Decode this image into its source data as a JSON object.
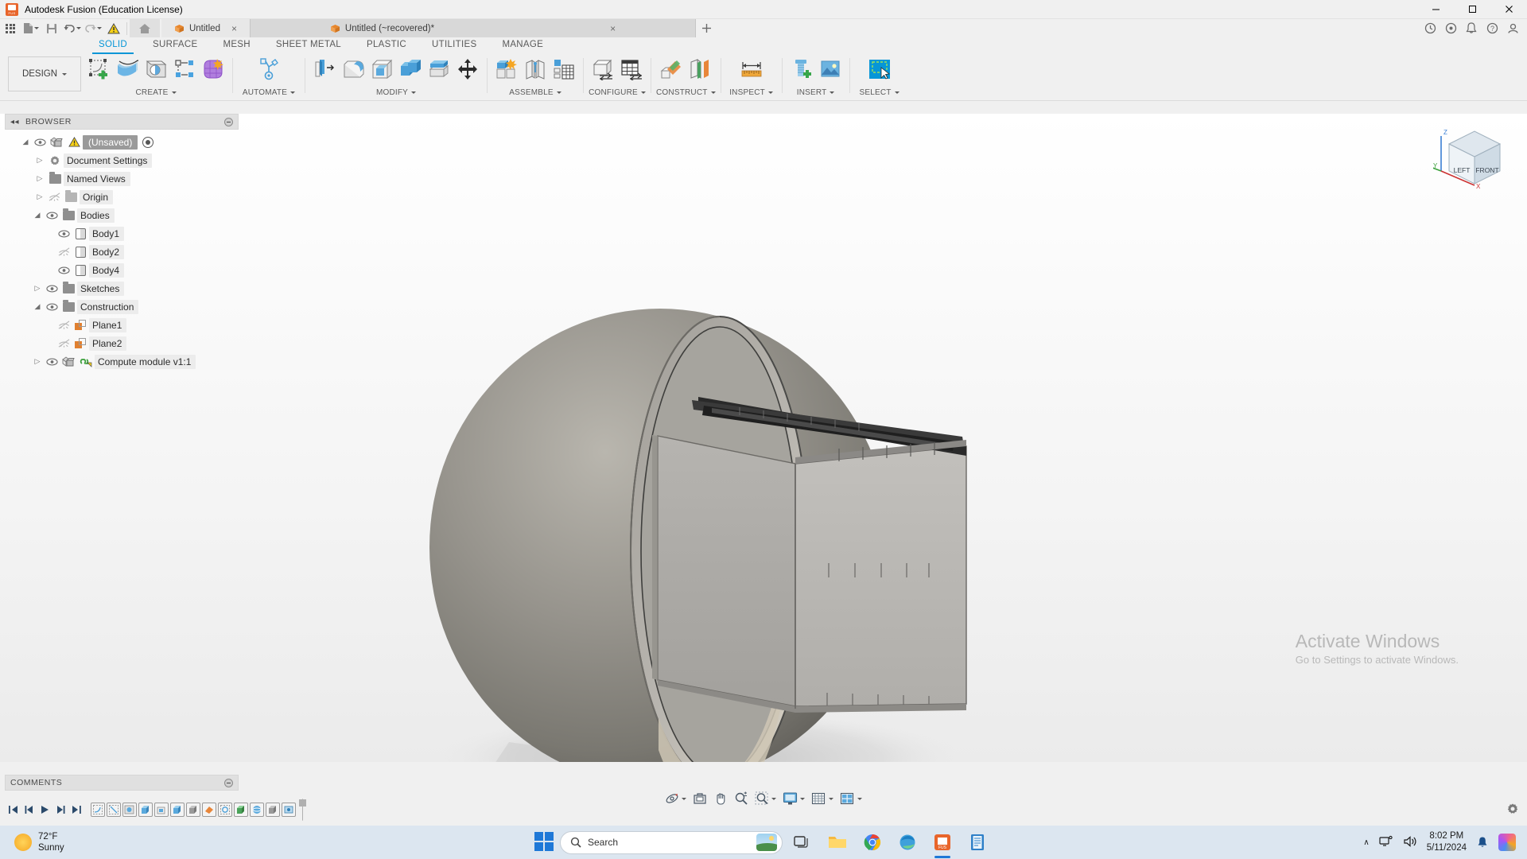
{
  "titlebar": {
    "title": "Autodesk Fusion (Education License)",
    "app_icon": "fusion-logo-icon",
    "minimize": "minimize-icon",
    "maximize": "maximize-icon",
    "close": "close-icon"
  },
  "quick_access": {
    "items": [
      {
        "name": "app-grid-icon",
        "label": ""
      },
      {
        "name": "new-document-icon",
        "label": ""
      },
      {
        "name": "save-icon",
        "label": ""
      },
      {
        "name": "undo-icon",
        "label": ""
      },
      {
        "name": "redo-icon",
        "label": ""
      },
      {
        "name": "warning-icon",
        "label": ""
      }
    ],
    "home_label": "home-icon",
    "tabs": [
      {
        "label": "Untitled",
        "active": true,
        "close": "×"
      },
      {
        "label": "Untitled (~recovered)*",
        "active": false,
        "close": "×"
      }
    ],
    "right_icons": [
      "add-tab-icon",
      "job-status-icon",
      "extensions-icon",
      "notifications-icon",
      "help-icon",
      "account-icon"
    ]
  },
  "ribbon": {
    "tabs": [
      {
        "label": "SOLID",
        "active": true
      },
      {
        "label": "SURFACE",
        "active": false
      },
      {
        "label": "MESH",
        "active": false
      },
      {
        "label": "SHEET METAL",
        "active": false
      },
      {
        "label": "PLASTIC",
        "active": false
      },
      {
        "label": "UTILITIES",
        "active": false
      },
      {
        "label": "MANAGE",
        "active": false
      }
    ],
    "workspace_selector": {
      "label": "DESIGN",
      "caret": "▾"
    },
    "panels": [
      {
        "label": "CREATE",
        "commands": [
          {
            "name": "create-sketch-icon"
          },
          {
            "name": "loft-icon"
          },
          {
            "name": "revolve-icon"
          },
          {
            "name": "pattern-icon"
          },
          {
            "name": "form-icon"
          }
        ]
      },
      {
        "label": "AUTOMATE",
        "commands": [
          {
            "name": "automated-modeling-icon"
          }
        ]
      },
      {
        "label": "MODIFY",
        "commands": [
          {
            "name": "press-pull-icon"
          },
          {
            "name": "fillet-icon"
          },
          {
            "name": "shell-icon"
          },
          {
            "name": "combine-icon"
          },
          {
            "name": "split-face-icon"
          },
          {
            "name": "move-copy-icon"
          }
        ]
      },
      {
        "label": "ASSEMBLE",
        "commands": [
          {
            "name": "new-component-icon"
          },
          {
            "name": "joint-icon"
          },
          {
            "name": "bill-of-materials-icon"
          }
        ]
      },
      {
        "label": "CONFIGURE",
        "commands": [
          {
            "name": "configured-feature-icon"
          },
          {
            "name": "configuration-table-icon"
          }
        ]
      },
      {
        "label": "CONSTRUCT",
        "commands": [
          {
            "name": "offset-plane-icon"
          },
          {
            "name": "plane-through-points-icon"
          }
        ]
      },
      {
        "label": "INSPECT",
        "commands": [
          {
            "name": "measure-icon"
          }
        ]
      },
      {
        "label": "INSERT",
        "commands": [
          {
            "name": "insert-mcmaster-icon"
          },
          {
            "name": "insert-canvas-icon"
          }
        ]
      },
      {
        "label": "SELECT",
        "commands": [
          {
            "name": "select-window-icon"
          }
        ]
      }
    ]
  },
  "browser": {
    "title": "BROWSER",
    "collapse_icon": "collapse-left-icon",
    "settings_icon": "panel-settings-icon",
    "tree": [
      {
        "label": "(Unsaved)",
        "indent": 0,
        "expander": "expanded",
        "eye": "visible",
        "icon": "component-icon",
        "warning": true,
        "root": true,
        "activate_dot": true
      },
      {
        "label": "Document Settings",
        "indent": 1,
        "expander": "collapsed",
        "eye": "none",
        "icon": "gear-icon"
      },
      {
        "label": "Named Views",
        "indent": 1,
        "expander": "collapsed",
        "eye": "none",
        "icon": "folder-icon"
      },
      {
        "label": "Origin",
        "indent": 1,
        "expander": "collapsed",
        "eye": "hidden",
        "icon": "folder-icon-dim"
      },
      {
        "label": "Bodies",
        "indent": 1,
        "expander": "expanded",
        "eye": "visible",
        "icon": "folder-icon"
      },
      {
        "label": "Body1",
        "indent": 2,
        "expander": "none",
        "eye": "visible",
        "icon": "body-icon"
      },
      {
        "label": "Body2",
        "indent": 2,
        "expander": "none",
        "eye": "hidden",
        "icon": "body-icon"
      },
      {
        "label": "Body4",
        "indent": 2,
        "expander": "none",
        "eye": "visible",
        "icon": "body-icon"
      },
      {
        "label": "Sketches",
        "indent": 1,
        "expander": "collapsed",
        "eye": "visible",
        "icon": "folder-icon"
      },
      {
        "label": "Construction",
        "indent": 1,
        "expander": "expanded",
        "eye": "visible",
        "icon": "folder-icon"
      },
      {
        "label": "Plane1",
        "indent": 2,
        "expander": "none",
        "eye": "hidden",
        "icon": "plane-icon"
      },
      {
        "label": "Plane2",
        "indent": 2,
        "expander": "none",
        "eye": "hidden",
        "icon": "plane-icon"
      },
      {
        "label": "Compute module v1:1",
        "indent": 1,
        "expander": "collapsed",
        "eye": "visible",
        "icon": "component-linked-icon"
      }
    ]
  },
  "canvas": {
    "model_description": "Grey hemispherical shell enclosure with rectangular module inserted",
    "viewcube": {
      "top_face": "",
      "left_label": "LEFT",
      "front_label": "FRONT",
      "axis_x": "X",
      "axis_y": "Y",
      "axis_z": "Z"
    }
  },
  "comments": {
    "title": "COMMENTS",
    "settings_icon": "panel-settings-icon"
  },
  "navbar": {
    "items": [
      {
        "name": "orbit-icon",
        "caret": true
      },
      {
        "name": "look-at-icon",
        "caret": false
      },
      {
        "name": "pan-icon",
        "caret": false
      },
      {
        "name": "zoom-icon",
        "caret": false
      },
      {
        "name": "fit-icon",
        "caret": true
      },
      {
        "name": "display-settings-icon",
        "caret": true
      },
      {
        "name": "grid-snap-icon",
        "caret": true
      },
      {
        "name": "viewports-icon",
        "caret": true
      }
    ]
  },
  "timeline": {
    "controls": [
      {
        "name": "jump-to-beginning-icon"
      },
      {
        "name": "step-back-icon"
      },
      {
        "name": "play-icon"
      },
      {
        "name": "step-forward-icon"
      },
      {
        "name": "jump-to-end-icon"
      }
    ],
    "features": [
      {
        "name": "timeline-feature-sketch"
      },
      {
        "name": "timeline-feature-sketch"
      },
      {
        "name": "timeline-feature-revolve"
      },
      {
        "name": "timeline-feature-extrude"
      },
      {
        "name": "timeline-feature-shell"
      },
      {
        "name": "timeline-feature-extrude"
      },
      {
        "name": "timeline-feature-extrude"
      },
      {
        "name": "timeline-feature-plane"
      },
      {
        "name": "timeline-feature-sketch"
      },
      {
        "name": "timeline-feature-extrude"
      },
      {
        "name": "timeline-feature-sphere"
      },
      {
        "name": "timeline-feature-pattern"
      },
      {
        "name": "timeline-feature-joint"
      }
    ],
    "end_marker": "timeline-end-marker"
  },
  "watermark": {
    "line1": "Activate Windows",
    "line2": "Go to Settings to activate Windows."
  },
  "taskbar": {
    "weather": {
      "temperature": "72°F",
      "condition": "Sunny"
    },
    "start_label": "start-button",
    "search_placeholder": "Search",
    "apps": [
      {
        "name": "taskview-icon",
        "active": false
      },
      {
        "name": "file-explorer-icon",
        "active": false
      },
      {
        "name": "chrome-icon",
        "active": false
      },
      {
        "name": "edge-icon",
        "active": false
      },
      {
        "name": "fusion-icon",
        "active": true
      },
      {
        "name": "notepad-icon",
        "active": false
      }
    ],
    "tray": {
      "chevron": "∧",
      "network_icon": "network-icon",
      "volume_icon": "volume-icon",
      "time": "8:02 PM",
      "date": "5/11/2024",
      "notification_icon": "bell-icon",
      "copilot_icon": "copilot-icon"
    }
  },
  "colors": {
    "accent": "#0696d7",
    "titlebar_bg": "#f0f0f0",
    "taskbar_bg": "#dce6f0",
    "canvas_bg": "#fbfbfb"
  }
}
